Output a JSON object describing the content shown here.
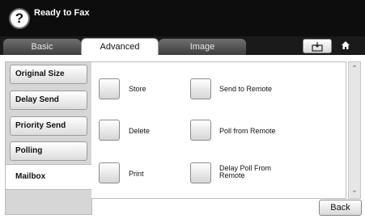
{
  "header": {
    "help_icon_glyph": "?",
    "status": "Ready to Fax"
  },
  "tabs": [
    {
      "label": "Basic",
      "selected": false
    },
    {
      "label": "Advanced",
      "selected": true
    },
    {
      "label": "Image",
      "selected": false
    }
  ],
  "toolbar_icons": [
    "fax-tray-icon",
    "home-icon"
  ],
  "sidebar": {
    "items": [
      {
        "label": "Original Size"
      },
      {
        "label": "Delay Send"
      },
      {
        "label": "Priority Send"
      },
      {
        "label": "Polling"
      },
      {
        "label": "Mailbox",
        "selected": true
      }
    ]
  },
  "functions": [
    {
      "label": "Store"
    },
    {
      "label": "Send to Remote"
    },
    {
      "label": "Delete"
    },
    {
      "label": "Poll from Remote"
    },
    {
      "label": "Print"
    },
    {
      "label": "Delay Poll From Remote"
    }
  ],
  "scroll": {
    "up_glyph": "⌃",
    "down_glyph": "⌄"
  },
  "footer": {
    "back_label": "Back"
  }
}
